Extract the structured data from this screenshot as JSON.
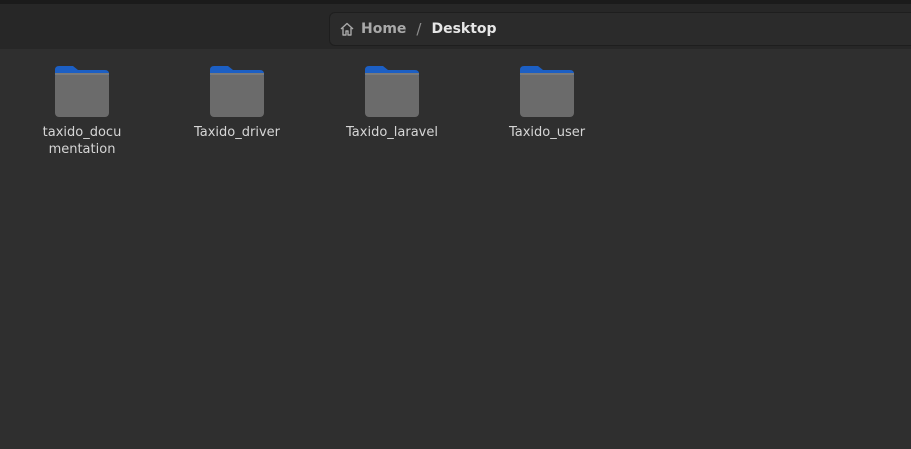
{
  "header": {
    "breadcrumb": [
      {
        "label": "Home",
        "icon": "home-icon"
      },
      {
        "label": "Desktop"
      }
    ],
    "separator": "/"
  },
  "files": [
    {
      "name": "taxido_documentation",
      "icon": "folder-icon"
    },
    {
      "name": "Taxido_driver",
      "icon": "folder-icon"
    },
    {
      "name": "Taxido_laravel",
      "icon": "folder-icon"
    },
    {
      "name": "Taxido_user",
      "icon": "folder-icon"
    }
  ],
  "colors": {
    "background": "#2f2f2f",
    "titlebar": "#272727",
    "folder_tab": "#1c5fc4",
    "folder_body": "#6b6b6b"
  }
}
